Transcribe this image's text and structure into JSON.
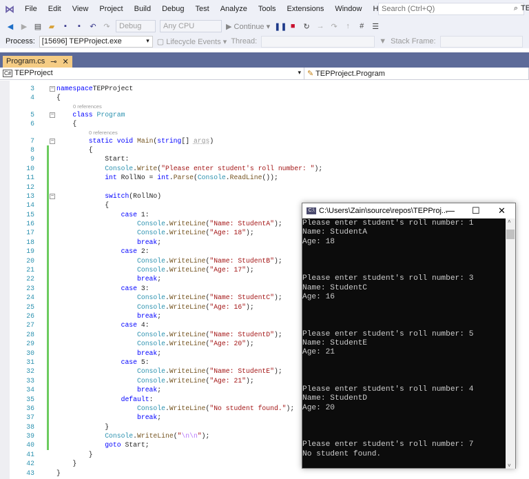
{
  "menu": {
    "items": [
      "File",
      "Edit",
      "View",
      "Project",
      "Build",
      "Debug",
      "Test",
      "Analyze",
      "Tools",
      "Extensions",
      "Window",
      "Help"
    ],
    "search_placeholder": "Search (Ctrl+Q)",
    "title_fragment": "TE"
  },
  "toolbar": {
    "config": "Debug",
    "platform": "Any CPU",
    "continue": "Continue"
  },
  "process_bar": {
    "process_label": "Process:",
    "process_value": "[15696] TEPProject.exe",
    "lifecycle": "Lifecycle Events",
    "thread_label": "Thread:",
    "stack_label": "Stack Frame:"
  },
  "tab": {
    "label": "Program.cs",
    "pin": "⊸",
    "close": "✕"
  },
  "nav": {
    "project": "TEPProject",
    "type": "TEPProject.Program"
  },
  "code": [
    {
      "n": "3",
      "fold": true,
      "t": [
        [
          "kw",
          "namespace"
        ],
        [
          "",
          "TEPProject"
        ]
      ]
    },
    {
      "n": "4",
      "t": [
        [
          "",
          "{"
        ]
      ]
    },
    {
      "refs": "0 references",
      "indent": 1
    },
    {
      "n": "5",
      "fold": true,
      "indent": 1,
      "t": [
        [
          "kw",
          "class "
        ],
        [
          "ty",
          "Program"
        ]
      ]
    },
    {
      "n": "6",
      "indent": 1,
      "t": [
        [
          "",
          "{"
        ]
      ]
    },
    {
      "refs": "0 references",
      "indent": 2
    },
    {
      "n": "7",
      "fold": true,
      "indent": 2,
      "t": [
        [
          "kw",
          "static void "
        ],
        [
          "fn",
          "Main"
        ],
        [
          "",
          "("
        ],
        [
          "kw",
          "string"
        ],
        [
          "",
          "[] "
        ],
        [
          "pa",
          "args"
        ],
        [
          "",
          ")"
        ]
      ]
    },
    {
      "n": "8",
      "chg": true,
      "indent": 2,
      "t": [
        [
          "",
          "{"
        ]
      ]
    },
    {
      "n": "9",
      "chg": true,
      "indent": 3,
      "t": [
        [
          "",
          "Start:"
        ]
      ]
    },
    {
      "n": "10",
      "chg": true,
      "indent": 3,
      "t": [
        [
          "ty",
          "Console"
        ],
        [
          "",
          "."
        ],
        [
          "fn",
          "Write"
        ],
        [
          "",
          "("
        ],
        [
          "st",
          "\"Please enter student's roll number: \""
        ],
        [
          "",
          ");"
        ]
      ]
    },
    {
      "n": "11",
      "chg": true,
      "indent": 3,
      "t": [
        [
          "kw",
          "int"
        ],
        [
          "",
          " RollNo = "
        ],
        [
          "kw",
          "int"
        ],
        [
          "",
          "."
        ],
        [
          "fn",
          "Parse"
        ],
        [
          "",
          "("
        ],
        [
          "ty",
          "Console"
        ],
        [
          "",
          "."
        ],
        [
          "fn",
          "ReadLine"
        ],
        [
          "",
          "());"
        ]
      ]
    },
    {
      "n": "12",
      "chg": true,
      "t": []
    },
    {
      "n": "13",
      "chg": true,
      "fold": true,
      "indent": 3,
      "t": [
        [
          "kw",
          "switch"
        ],
        [
          "",
          "(RollNo)"
        ]
      ]
    },
    {
      "n": "14",
      "chg": true,
      "indent": 3,
      "t": [
        [
          "",
          "{"
        ]
      ]
    },
    {
      "n": "15",
      "chg": true,
      "indent": 4,
      "t": [
        [
          "kw",
          "case"
        ],
        [
          "",
          " 1:"
        ]
      ]
    },
    {
      "n": "16",
      "chg": true,
      "indent": 5,
      "t": [
        [
          "ty",
          "Console"
        ],
        [
          "",
          "."
        ],
        [
          "fn",
          "WriteLine"
        ],
        [
          "",
          "("
        ],
        [
          "st",
          "\"Name: StudentA\""
        ],
        [
          "",
          ");"
        ]
      ]
    },
    {
      "n": "17",
      "chg": true,
      "indent": 5,
      "t": [
        [
          "ty",
          "Console"
        ],
        [
          "",
          "."
        ],
        [
          "fn",
          "WriteLine"
        ],
        [
          "",
          "("
        ],
        [
          "st",
          "\"Age: 18\""
        ],
        [
          "",
          ");"
        ]
      ]
    },
    {
      "n": "18",
      "chg": true,
      "indent": 5,
      "t": [
        [
          "kw",
          "break"
        ],
        [
          "",
          ";"
        ]
      ]
    },
    {
      "n": "19",
      "chg": true,
      "indent": 4,
      "t": [
        [
          "kw",
          "case"
        ],
        [
          "",
          " 2:"
        ]
      ]
    },
    {
      "n": "20",
      "chg": true,
      "indent": 5,
      "t": [
        [
          "ty",
          "Console"
        ],
        [
          "",
          "."
        ],
        [
          "fn",
          "WriteLine"
        ],
        [
          "",
          "("
        ],
        [
          "st",
          "\"Name: StudentB\""
        ],
        [
          "",
          ");"
        ]
      ]
    },
    {
      "n": "21",
      "chg": true,
      "indent": 5,
      "t": [
        [
          "ty",
          "Console"
        ],
        [
          "",
          "."
        ],
        [
          "fn",
          "WriteLine"
        ],
        [
          "",
          "("
        ],
        [
          "st",
          "\"Age: 17\""
        ],
        [
          "",
          ");"
        ]
      ]
    },
    {
      "n": "22",
      "chg": true,
      "indent": 5,
      "t": [
        [
          "kw",
          "break"
        ],
        [
          "",
          ";"
        ]
      ]
    },
    {
      "n": "23",
      "chg": true,
      "indent": 4,
      "t": [
        [
          "kw",
          "case"
        ],
        [
          "",
          " 3:"
        ]
      ]
    },
    {
      "n": "24",
      "chg": true,
      "indent": 5,
      "t": [
        [
          "ty",
          "Console"
        ],
        [
          "",
          "."
        ],
        [
          "fn",
          "WriteLine"
        ],
        [
          "",
          "("
        ],
        [
          "st",
          "\"Name: StudentC\""
        ],
        [
          "",
          ");"
        ]
      ]
    },
    {
      "n": "25",
      "chg": true,
      "indent": 5,
      "t": [
        [
          "ty",
          "Console"
        ],
        [
          "",
          "."
        ],
        [
          "fn",
          "WriteLine"
        ],
        [
          "",
          "("
        ],
        [
          "st",
          "\"Age: 16\""
        ],
        [
          "",
          ");"
        ]
      ]
    },
    {
      "n": "26",
      "chg": true,
      "indent": 5,
      "t": [
        [
          "kw",
          "break"
        ],
        [
          "",
          ";"
        ]
      ]
    },
    {
      "n": "27",
      "chg": true,
      "indent": 4,
      "t": [
        [
          "kw",
          "case"
        ],
        [
          "",
          " 4:"
        ]
      ]
    },
    {
      "n": "28",
      "chg": true,
      "indent": 5,
      "t": [
        [
          "ty",
          "Console"
        ],
        [
          "",
          "."
        ],
        [
          "fn",
          "WriteLine"
        ],
        [
          "",
          "("
        ],
        [
          "st",
          "\"Name: StudentD\""
        ],
        [
          "",
          ");"
        ]
      ]
    },
    {
      "n": "29",
      "chg": true,
      "indent": 5,
      "t": [
        [
          "ty",
          "Console"
        ],
        [
          "",
          "."
        ],
        [
          "fn",
          "WriteLine"
        ],
        [
          "",
          "("
        ],
        [
          "st",
          "\"Age: 20\""
        ],
        [
          "",
          ");"
        ]
      ]
    },
    {
      "n": "30",
      "chg": true,
      "indent": 5,
      "t": [
        [
          "kw",
          "break"
        ],
        [
          "",
          ";"
        ]
      ]
    },
    {
      "n": "31",
      "chg": true,
      "indent": 4,
      "t": [
        [
          "kw",
          "case"
        ],
        [
          "",
          " 5:"
        ]
      ]
    },
    {
      "n": "32",
      "chg": true,
      "indent": 5,
      "t": [
        [
          "ty",
          "Console"
        ],
        [
          "",
          "."
        ],
        [
          "fn",
          "WriteLine"
        ],
        [
          "",
          "("
        ],
        [
          "st",
          "\"Name: StudentE\""
        ],
        [
          "",
          ");"
        ]
      ]
    },
    {
      "n": "33",
      "chg": true,
      "indent": 5,
      "t": [
        [
          "ty",
          "Console"
        ],
        [
          "",
          "."
        ],
        [
          "fn",
          "WriteLine"
        ],
        [
          "",
          "("
        ],
        [
          "st",
          "\"Age: 21\""
        ],
        [
          "",
          ");"
        ]
      ]
    },
    {
      "n": "34",
      "chg": true,
      "indent": 5,
      "t": [
        [
          "kw",
          "break"
        ],
        [
          "",
          ";"
        ]
      ]
    },
    {
      "n": "35",
      "chg": true,
      "indent": 4,
      "t": [
        [
          "kw",
          "default"
        ],
        [
          "",
          ":"
        ]
      ]
    },
    {
      "n": "36",
      "chg": true,
      "indent": 5,
      "t": [
        [
          "ty",
          "Console"
        ],
        [
          "",
          "."
        ],
        [
          "fn",
          "WriteLine"
        ],
        [
          "",
          "("
        ],
        [
          "st",
          "\"No student found.\""
        ],
        [
          "",
          ");"
        ]
      ]
    },
    {
      "n": "37",
      "chg": true,
      "indent": 5,
      "t": [
        [
          "kw",
          "break"
        ],
        [
          "",
          ";"
        ]
      ]
    },
    {
      "n": "38",
      "chg": true,
      "indent": 3,
      "t": [
        [
          "",
          "}"
        ]
      ]
    },
    {
      "n": "39",
      "chg": true,
      "indent": 3,
      "t": [
        [
          "ty",
          "Console"
        ],
        [
          "",
          "."
        ],
        [
          "fn",
          "WriteLine"
        ],
        [
          "",
          "("
        ],
        [
          "st",
          "\""
        ],
        [
          "es",
          "\\n\\n"
        ],
        [
          "st",
          "\""
        ],
        [
          "",
          ");"
        ]
      ]
    },
    {
      "n": "40",
      "chg": true,
      "indent": 3,
      "t": [
        [
          "kw",
          "goto"
        ],
        [
          "",
          " Start;"
        ]
      ]
    },
    {
      "n": "41",
      "indent": 2,
      "t": [
        [
          "",
          "}"
        ]
      ]
    },
    {
      "n": "42",
      "indent": 1,
      "t": [
        [
          "",
          "}"
        ]
      ]
    },
    {
      "n": "43",
      "t": [
        [
          "",
          "}"
        ]
      ]
    }
  ],
  "console": {
    "title": "C:\\Users\\Zain\\source\\repos\\TEPProj...",
    "minimize": "—",
    "maximize": "☐",
    "close": "✕",
    "output": [
      "Please enter student's roll number: 1",
      "Name: StudentA",
      "Age: 18",
      "",
      "",
      "",
      "Please enter student's roll number: 3",
      "Name: StudentC",
      "Age: 16",
      "",
      "",
      "",
      "Please enter student's roll number: 5",
      "Name: StudentE",
      "Age: 21",
      "",
      "",
      "",
      "Please enter student's roll number: 4",
      "Name: StudentD",
      "Age: 20",
      "",
      "",
      "",
      "Please enter student's roll number: 7",
      "No student found."
    ]
  }
}
